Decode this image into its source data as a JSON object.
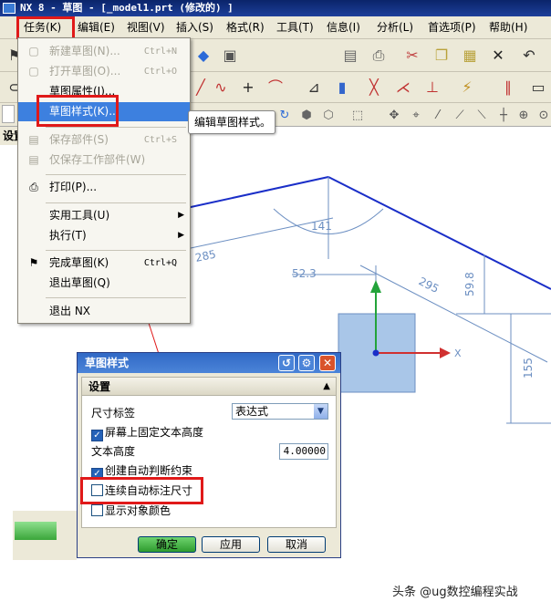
{
  "window": {
    "title": "NX 8 - 草图 - [_model1.prt  (修改的) ]"
  },
  "menubar": {
    "items": [
      "任务(K)",
      "编辑(E)",
      "视图(V)",
      "插入(S)",
      "格式(R)",
      "工具(T)",
      "信息(I)",
      "分析(L)",
      "首选项(P)",
      "帮助(H)"
    ],
    "active": "任务(K)"
  },
  "task_menu": {
    "items": [
      {
        "label": "新建草图(N)...",
        "shortcut": "Ctrl+N",
        "enabled": false,
        "icon": "new-sketch-icon"
      },
      {
        "label": "打开草图(O)...",
        "shortcut": "Ctrl+O",
        "enabled": false,
        "icon": "open-sketch-icon"
      },
      {
        "label": "草图属性(I)...",
        "shortcut": "",
        "enabled": true,
        "icon": ""
      },
      {
        "label": "草图样式(K)...",
        "shortcut": "",
        "enabled": true,
        "icon": "",
        "highlighted": true
      },
      {
        "label": "保存部件(S)",
        "shortcut": "Ctrl+S",
        "enabled": false,
        "icon": "save-icon"
      },
      {
        "label": "仅保存工作部件(W)",
        "shortcut": "",
        "enabled": false,
        "icon": "save-work-part-icon"
      },
      {
        "label": "打印(P)...",
        "shortcut": "",
        "enabled": true,
        "icon": "print-icon"
      },
      {
        "label": "实用工具(U)",
        "shortcut": "",
        "enabled": true,
        "icon": "",
        "submenu": true
      },
      {
        "label": "执行(T)",
        "shortcut": "",
        "enabled": true,
        "icon": "",
        "submenu": true
      },
      {
        "label": "完成草图(K)",
        "shortcut": "Ctrl+Q",
        "enabled": true,
        "icon": "finish-sketch-flag-icon"
      },
      {
        "label": "退出草图(Q)",
        "shortcut": "",
        "enabled": true,
        "icon": ""
      },
      {
        "label": "退出 NX",
        "shortcut": "",
        "enabled": true,
        "icon": ""
      }
    ]
  },
  "tooltip": {
    "text": "编辑草图样式。"
  },
  "left_panel": {
    "label": "设置"
  },
  "sketch": {
    "dimensions": [
      "141",
      "285",
      "52.3",
      "295",
      "59.8",
      "155"
    ],
    "axis_label": "X"
  },
  "dialog": {
    "title": "草图样式",
    "section": "设置",
    "dim_label_caption": "尺寸标签",
    "dim_label_value": "表达式",
    "fix_text_height": {
      "label": "屏幕上固定文本高度",
      "checked": true
    },
    "text_height_caption": "文本高度",
    "text_height_value": "4.00000",
    "auto_infer": {
      "label": "创建自动判断约束",
      "checked": true
    },
    "continuous_auto_dim": {
      "label": "连续自动标注尺寸",
      "checked": false
    },
    "show_object_color": {
      "label": "显示对象颜色",
      "checked": false
    },
    "buttons": {
      "ok": "确定",
      "apply": "应用",
      "cancel": "取消"
    }
  },
  "watermark": {
    "text": "头条 @ug数控编程实战"
  },
  "colors": {
    "sketch_line": "#1a2ec8",
    "dimension": "#6c8fc2",
    "highlight_box": "#e01919",
    "menu_highlight": "#3d80df",
    "title_bar": "#0a246a"
  }
}
